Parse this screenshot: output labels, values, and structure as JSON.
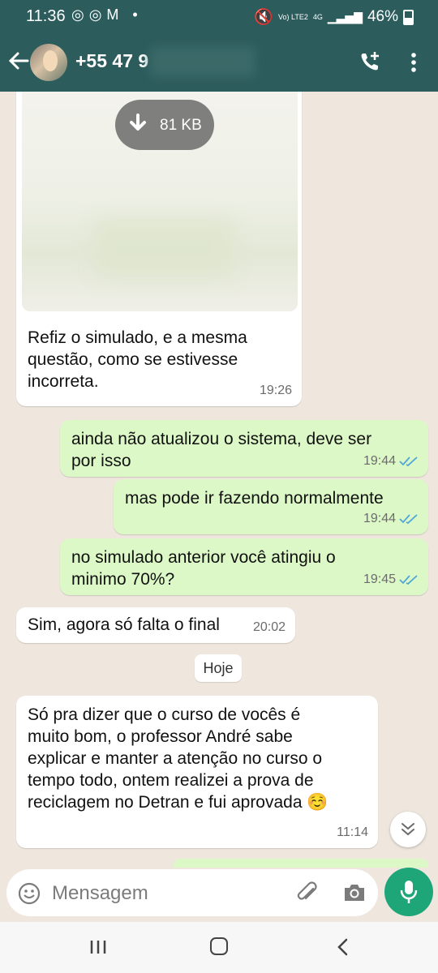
{
  "status_bar": {
    "time": "11:36",
    "signal_label": "Vo) LTE2",
    "network": "4G",
    "battery": "46%"
  },
  "header": {
    "contact_name": "+55 47 9"
  },
  "messages": [
    {
      "direction": "in",
      "text_lines": [
        "Refiz o simulado, e a mesma",
        "questão, como se estivesse",
        "incorreta."
      ],
      "time": "19:26",
      "attachment_size": "81 KB"
    },
    {
      "direction": "out",
      "text_lines": [
        "ainda não atualizou o sistema, deve ser",
        "por isso"
      ],
      "time": "19:44"
    },
    {
      "direction": "out",
      "text_lines": [
        "mas pode ir fazendo normalmente"
      ],
      "time": "19:44"
    },
    {
      "direction": "out",
      "text_lines": [
        "no simulado anterior você atingiu o",
        "minimo 70%?"
      ],
      "time": "19:45"
    },
    {
      "direction": "in",
      "text_lines": [
        "Sim, agora só falta o final"
      ],
      "time": "20:02"
    },
    {
      "direction": "in",
      "text_lines": [
        "Só pra dizer que o curso de vocês é",
        "muito bom, o professor André sabe",
        "explicar e manter a atenção no curso o",
        "tempo todo, ontem realizei a prova de",
        "reciclagem no Detran e fui aprovada ☺️"
      ],
      "time": "11:14"
    }
  ],
  "date_separator": "Hoje",
  "composer": {
    "placeholder": "Mensagem"
  },
  "colors": {
    "header": "#2d5c5d",
    "outgoing": "#dcf8c6",
    "incoming": "#ffffff",
    "accent": "#1fa678",
    "read_ticks": "#4fa6d8"
  },
  "icons": [
    "back-arrow-icon",
    "add-call-icon",
    "more-vert-icon",
    "download-icon",
    "double-check-icon",
    "chevron-down-icon",
    "emoji-icon",
    "paperclip-icon",
    "camera-icon",
    "mic-icon"
  ]
}
